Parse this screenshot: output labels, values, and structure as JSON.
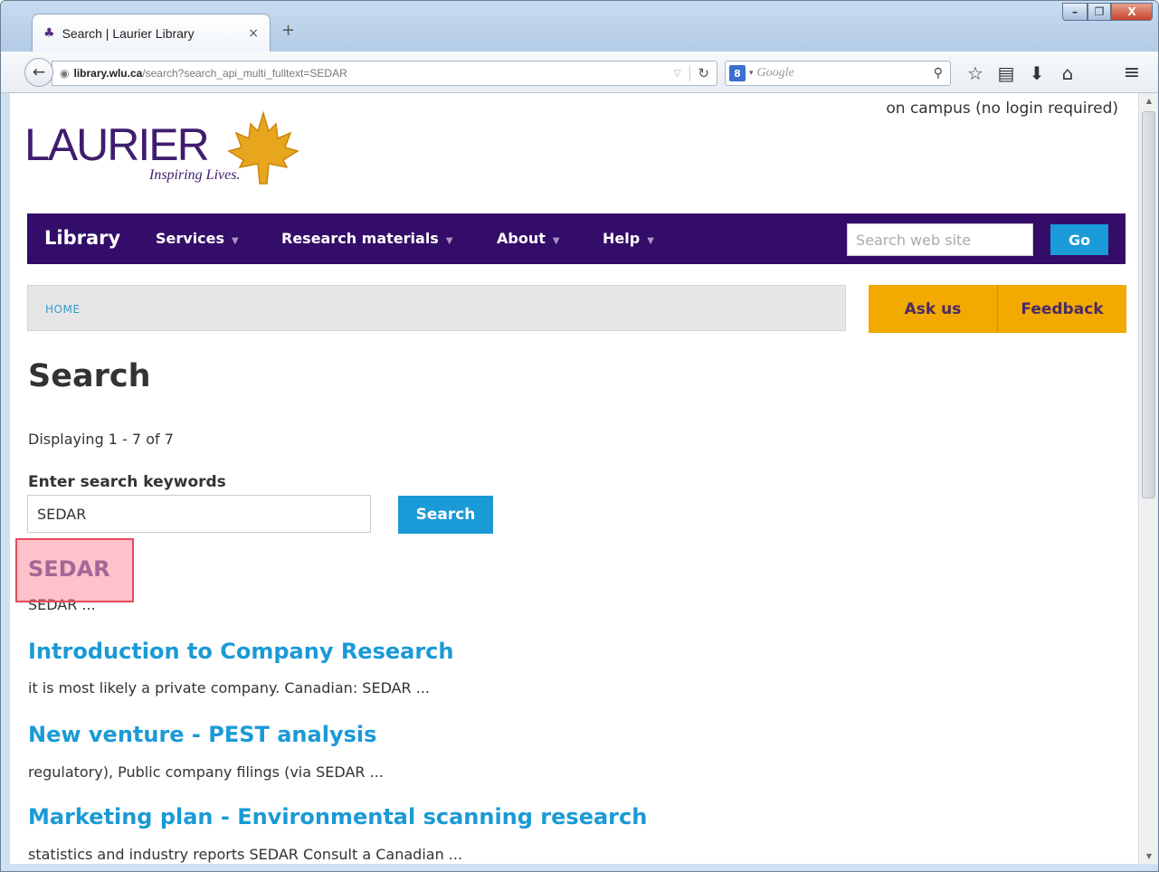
{
  "browser": {
    "tab_title": "Search | Laurier Library",
    "tab_close": "×",
    "new_tab": "+",
    "url_host": "library.wlu.ca",
    "url_path": "/search?search_api_multi_fulltext=SEDAR",
    "search_engine_placeholder": "Google",
    "window_controls": {
      "minimize": "–",
      "maximize": "❐",
      "close": "X"
    }
  },
  "header": {
    "campus_status": "on campus (no login required)",
    "logo_text": "LAURIER",
    "logo_tagline": "Inspiring Lives."
  },
  "nav": {
    "brand": "Library",
    "items": [
      {
        "label": "Services"
      },
      {
        "label": "Research materials"
      },
      {
        "label": "About"
      },
      {
        "label": "Help"
      }
    ],
    "search_placeholder": "Search web site",
    "go_label": "Go"
  },
  "breadcrumb": {
    "home": "HOME"
  },
  "actions": {
    "ask_us": "Ask us",
    "feedback": "Feedback"
  },
  "main": {
    "title": "Search",
    "displaying": "Displaying 1 - 7 of 7",
    "keywords_label": "Enter search keywords",
    "keywords_value": "SEDAR",
    "search_button": "Search",
    "results": [
      {
        "title": "SEDAR",
        "snippet": "SEDAR ..."
      },
      {
        "title": "Introduction to Company Research",
        "snippet": "it is most likely a private company. Canadian: SEDAR ..."
      },
      {
        "title": "New venture - PEST analysis",
        "snippet": "regulatory), Public company filings (via SEDAR ..."
      },
      {
        "title": "Marketing plan - Environmental scanning research",
        "snippet": "statistics and industry reports SEDAR Consult a Canadian ..."
      }
    ]
  },
  "colors": {
    "nav_purple": "#330d69",
    "link_blue": "#1a9ad6",
    "button_gold": "#f2a900",
    "highlight": "#e24a5c"
  }
}
